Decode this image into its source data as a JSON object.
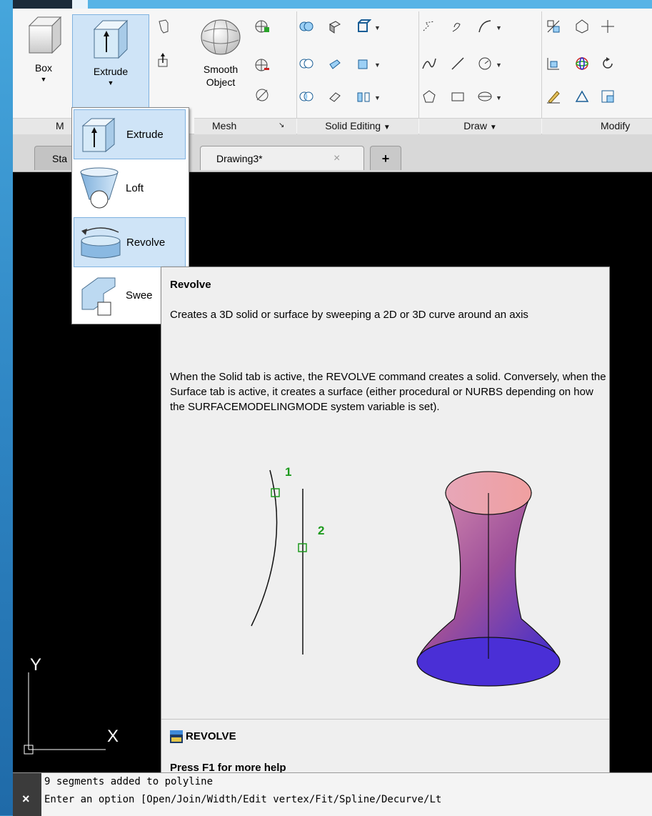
{
  "ribbon": {
    "panels": {
      "modeling_title": "M",
      "mesh_title": "Mesh",
      "solid_editing_title": "Solid Editing",
      "draw_title": "Draw",
      "modify_title": "Modify"
    },
    "box_label": "Box",
    "extrude_label": "Extrude",
    "smooth_label_line1": "Smooth",
    "smooth_label_line2": "Object"
  },
  "doc_tabs": {
    "start_tab": "Sta",
    "drawing_tab": "Drawing3*",
    "close_glyph": "×",
    "new_tab_glyph": "+"
  },
  "dropdown": {
    "items": [
      {
        "label": "Extrude"
      },
      {
        "label": "Loft"
      },
      {
        "label": "Revolve"
      },
      {
        "label": "Swee"
      }
    ]
  },
  "tooltip": {
    "title": "Revolve",
    "description": "Creates a 3D solid or surface by sweeping a 2D or 3D curve around an axis",
    "body": "When the Solid tab is active, the REVOLVE command creates a solid. Conversely, when the Surface tab is active, it creates a surface (either procedural or NURBS depending on how the SURFACEMODELINGMODE system variable is set).",
    "marker_1": "1",
    "marker_2": "2",
    "command": "REVOLVE",
    "help": "Press F1 for more help"
  },
  "ucs": {
    "x_label": "X",
    "y_label": "Y"
  },
  "command_line": {
    "close_glyph": "×",
    "line1": "9 segments added to polyline",
    "line2": "Enter an option [Open/Join/Width/Edit vertex/Fit/Spline/Decurve/Lt"
  },
  "colors": {
    "accent": "#3a90c8",
    "selection": "#cfe4f7",
    "canvas": "#000000",
    "marker": "#1d9a1d"
  }
}
